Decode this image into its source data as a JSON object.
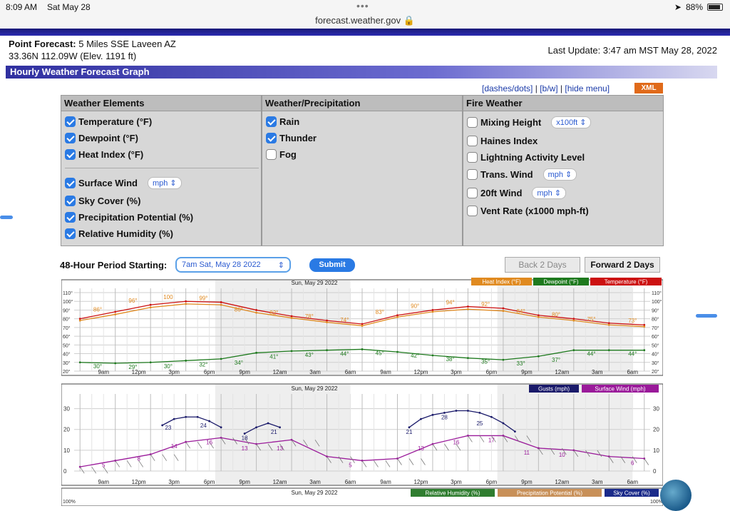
{
  "statusbar": {
    "time": "8:09 AM",
    "date": "Sat May 28",
    "url": "forecast.weather.gov",
    "battery": "88%"
  },
  "header": {
    "point_label": "Point Forecast:",
    "point_value": "5 Miles SSE Laveen AZ",
    "coords": "33.36N 112.09W (Elev. 1191 ft)",
    "last_update": "Last Update: 3:47 am MST May 28, 2022"
  },
  "section_title": "Hourly Weather Forecast Graph",
  "menu": {
    "dashes": "[dashes/dots]",
    "bw": "[b/w]",
    "hide": "[hide menu]",
    "sep": "|",
    "xml": "XML"
  },
  "panels": {
    "weather_elements": {
      "title": "Weather Elements",
      "items": [
        {
          "label": "Temperature (°F)",
          "checked": true
        },
        {
          "label": "Dewpoint (°F)",
          "checked": true
        },
        {
          "label": "Heat Index (°F)",
          "checked": true
        },
        {
          "label": "Surface Wind",
          "checked": true,
          "unit": "mph"
        },
        {
          "label": "Sky Cover (%)",
          "checked": true
        },
        {
          "label": "Precipitation Potential (%)",
          "checked": true
        },
        {
          "label": "Relative Humidity (%)",
          "checked": true
        }
      ]
    },
    "weather_precip": {
      "title": "Weather/Precipitation",
      "items": [
        {
          "label": "Rain",
          "checked": true
        },
        {
          "label": "Thunder",
          "checked": true
        },
        {
          "label": "Fog",
          "checked": false
        }
      ]
    },
    "fire_weather": {
      "title": "Fire Weather",
      "items": [
        {
          "label": "Mixing Height",
          "checked": false,
          "unit": "x100ft"
        },
        {
          "label": "Haines Index",
          "checked": false
        },
        {
          "label": "Lightning Activity Level",
          "checked": false
        },
        {
          "label": "Trans. Wind",
          "checked": false,
          "unit": "mph"
        },
        {
          "label": "20ft Wind",
          "checked": false,
          "unit": "mph"
        },
        {
          "label": "Vent Rate (x1000 mph-ft)",
          "checked": false
        }
      ]
    }
  },
  "period": {
    "label": "48-Hour Period Starting:",
    "selected": "7am Sat, May 28 2022",
    "submit": "Submit",
    "back": "Back 2 Days",
    "forward": "Forward 2 Days"
  },
  "colors": {
    "temperature": "#cc1111",
    "heat_index": "#e08a20",
    "dewpoint": "#1e7a1e",
    "gusts": "#1a1a6a",
    "surface_wind": "#9a1a9a",
    "rh_legend": "#2f7d2f",
    "pp_legend": "#c89058",
    "sky_legend": "#1a2a8a"
  },
  "chart_data": [
    {
      "type": "line",
      "title": "Sun, May 29 2022",
      "legend": [
        "Heat Index (°F)",
        "Dewpoint (°F)",
        "Temperature (°F)"
      ],
      "x_ticks": [
        "9am",
        "12pm",
        "3pm",
        "6pm",
        "9pm",
        "12am",
        "3am",
        "6am",
        "9am",
        "12pm",
        "3pm",
        "6pm",
        "9pm",
        "12am",
        "3am",
        "6am"
      ],
      "y_ticks": [
        "110°",
        "100°",
        "90°",
        "80°",
        "70°",
        "60°",
        "50°",
        "40°",
        "30°",
        "20°"
      ],
      "ylim": [
        20,
        110
      ],
      "series": [
        {
          "name": "Temperature (°F)",
          "x": [
            0,
            3,
            6,
            9,
            12,
            15,
            18,
            21,
            24,
            27,
            30,
            33,
            36,
            39,
            42,
            45,
            48
          ],
          "values": [
            80,
            88,
            96,
            100,
            99,
            90,
            83,
            78,
            74,
            84,
            90,
            94,
            92,
            84,
            80,
            75,
            73
          ]
        },
        {
          "name": "Heat Index (°F)",
          "x": [
            0,
            3,
            6,
            9,
            12,
            15,
            18,
            21,
            24,
            27,
            30,
            33,
            36,
            39,
            42,
            45,
            48
          ],
          "values": [
            78,
            85,
            93,
            97,
            96,
            87,
            81,
            76,
            72,
            82,
            88,
            91,
            89,
            82,
            78,
            73,
            71
          ]
        },
        {
          "name": "Dewpoint (°F)",
          "x": [
            0,
            3,
            6,
            9,
            12,
            15,
            18,
            21,
            24,
            27,
            30,
            33,
            36,
            39,
            42,
            45,
            48
          ],
          "values": [
            30,
            29,
            30,
            32,
            34,
            41,
            43,
            44,
            45,
            42,
            38,
            35,
            33,
            37,
            44,
            44,
            44
          ]
        }
      ],
      "temp_labels": [
        {
          "x": 1.5,
          "y": 86,
          "text": "86°"
        },
        {
          "x": 4.5,
          "y": 96,
          "text": "96°"
        },
        {
          "x": 7.5,
          "y": 100,
          "text": "100"
        },
        {
          "x": 10.5,
          "y": 99,
          "text": "99°"
        },
        {
          "x": 13.5,
          "y": 86,
          "text": "86°"
        },
        {
          "x": 16.5,
          "y": 82,
          "text": "82°"
        },
        {
          "x": 19.5,
          "y": 78,
          "text": "78°"
        },
        {
          "x": 22.5,
          "y": 74,
          "text": "74°"
        },
        {
          "x": 25.5,
          "y": 83,
          "text": "83°"
        },
        {
          "x": 28.5,
          "y": 90,
          "text": "90°"
        },
        {
          "x": 31.5,
          "y": 94,
          "text": "94°"
        },
        {
          "x": 34.5,
          "y": 92,
          "text": "92°"
        },
        {
          "x": 37.5,
          "y": 84,
          "text": "84°"
        },
        {
          "x": 40.5,
          "y": 80,
          "text": "80°"
        },
        {
          "x": 43.5,
          "y": 75,
          "text": "75°"
        },
        {
          "x": 47,
          "y": 73,
          "text": "73°"
        }
      ],
      "dew_labels": [
        {
          "x": 1.5,
          "y": 30,
          "text": "30°"
        },
        {
          "x": 4.5,
          "y": 29,
          "text": "29°"
        },
        {
          "x": 7.5,
          "y": 30,
          "text": "30°"
        },
        {
          "x": 10.5,
          "y": 32,
          "text": "32°"
        },
        {
          "x": 13.5,
          "y": 34,
          "text": "34°"
        },
        {
          "x": 16.5,
          "y": 41,
          "text": "41°"
        },
        {
          "x": 19.5,
          "y": 43,
          "text": "43°"
        },
        {
          "x": 22.5,
          "y": 44,
          "text": "44°"
        },
        {
          "x": 25.5,
          "y": 45,
          "text": "45°"
        },
        {
          "x": 28.5,
          "y": 42,
          "text": "42°"
        },
        {
          "x": 31.5,
          "y": 38,
          "text": "38°"
        },
        {
          "x": 34.5,
          "y": 35,
          "text": "35°"
        },
        {
          "x": 37.5,
          "y": 33,
          "text": "33°"
        },
        {
          "x": 40.5,
          "y": 37,
          "text": "37°"
        },
        {
          "x": 43.5,
          "y": 44,
          "text": "44°"
        },
        {
          "x": 47,
          "y": 44,
          "text": "44°"
        }
      ]
    },
    {
      "type": "line",
      "title": "Sun, May 29 2022",
      "legend": [
        "Gusts (mph)",
        "Surface Wind (mph)"
      ],
      "x_ticks": [
        "9am",
        "12pm",
        "3pm",
        "6pm",
        "9pm",
        "12am",
        "3am",
        "6am",
        "9am",
        "12pm",
        "3pm",
        "6pm",
        "9pm",
        "12am",
        "3am",
        "6am"
      ],
      "y_ticks": [
        "30",
        "20",
        "10",
        "0"
      ],
      "ylim": [
        0,
        35
      ],
      "series": [
        {
          "name": "Surface Wind (mph)",
          "x": [
            0,
            3,
            6,
            9,
            12,
            15,
            18,
            21,
            24,
            27,
            30,
            33,
            36,
            39,
            42,
            45,
            48
          ],
          "values": [
            2,
            5,
            8,
            14,
            16,
            13,
            15,
            7,
            5,
            6,
            13,
            17,
            17,
            11,
            10,
            7,
            6
          ]
        },
        {
          "name": "Gusts (mph)",
          "segments": [
            {
              "x": [
                7,
                8,
                9,
                10,
                11,
                12
              ],
              "values": [
                22,
                25,
                26,
                26,
                24,
                21
              ]
            },
            {
              "x": [
                14,
                15,
                16,
                17
              ],
              "values": [
                18,
                21,
                23,
                21
              ]
            },
            {
              "x": [
                28,
                29,
                30,
                31,
                32,
                33,
                34,
                35,
                36,
                37
              ],
              "values": [
                21,
                25,
                27,
                28,
                29,
                29,
                28,
                26,
                23,
                19
              ]
            }
          ]
        }
      ],
      "wind_labels": [
        {
          "x": 2,
          "y": 5,
          "text": "5"
        },
        {
          "x": 5,
          "y": 8,
          "text": "8"
        },
        {
          "x": 8,
          "y": 14,
          "text": "14"
        },
        {
          "x": 11,
          "y": 16,
          "text": "16"
        },
        {
          "x": 14,
          "y": 13,
          "text": "13"
        },
        {
          "x": 17,
          "y": 13,
          "text": "13"
        },
        {
          "x": 23,
          "y": 5,
          "text": "5"
        },
        {
          "x": 29,
          "y": 13,
          "text": "13"
        },
        {
          "x": 32,
          "y": 16,
          "text": "16"
        },
        {
          "x": 35,
          "y": 17,
          "text": "17"
        },
        {
          "x": 38,
          "y": 11,
          "text": "11"
        },
        {
          "x": 41,
          "y": 10,
          "text": "10"
        },
        {
          "x": 47,
          "y": 6,
          "text": "6"
        }
      ],
      "gust_labels": [
        {
          "x": 7.5,
          "y": 23,
          "text": "23"
        },
        {
          "x": 10.5,
          "y": 24,
          "text": "24"
        },
        {
          "x": 14,
          "y": 18,
          "text": "18"
        },
        {
          "x": 16.5,
          "y": 21,
          "text": "21"
        },
        {
          "x": 28,
          "y": 21,
          "text": "21"
        },
        {
          "x": 31,
          "y": 28,
          "text": "28"
        },
        {
          "x": 34,
          "y": 25,
          "text": "25"
        }
      ]
    },
    {
      "type": "line",
      "title": "Sun, May 29 2022",
      "legend": [
        "Relative Humidity (%)",
        "Precipitation Potential (%)",
        "Sky Cover (%)"
      ],
      "y_ticks": [
        "100%"
      ],
      "series": []
    }
  ]
}
